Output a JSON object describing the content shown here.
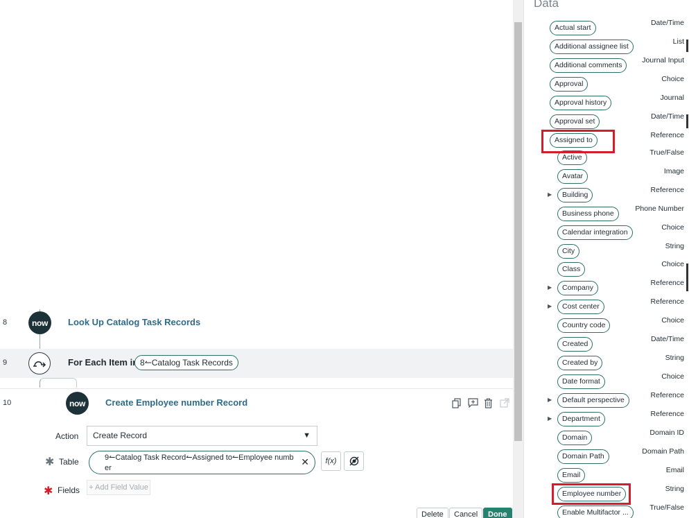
{
  "flow": {
    "step8": {
      "number": "8",
      "icon": "now-logo-icon",
      "title": "Look Up Catalog Task Records"
    },
    "step9": {
      "number": "9",
      "icon": "loop-icon",
      "prefix": "For Each Item in",
      "pill": "8↼Catalog Task Records"
    },
    "step10": {
      "number": "10",
      "icon": "now-logo-icon",
      "title": "Create Employee number Record",
      "action_label": "Action",
      "action_value": "Create Record",
      "table_label": "Table",
      "table_value": "9↼Catalog Task Record↼Assigned to↼Employee number",
      "fields_label": "Fields",
      "add_field_placeholder": "+ Add Field Value",
      "fx_label": "f(x)",
      "buttons": {
        "delete": "Delete",
        "cancel": "Cancel",
        "done": "Done"
      }
    }
  },
  "data_panel": {
    "title": "Data",
    "items": [
      {
        "label": "Actual start",
        "type": "Date/Time"
      },
      {
        "label": "Additional assignee list",
        "type": "List"
      },
      {
        "label": "Additional comments",
        "type": "Journal Input"
      },
      {
        "label": "Approval",
        "type": "Choice"
      },
      {
        "label": "Approval history",
        "type": "Journal"
      },
      {
        "label": "Approval set",
        "type": "Date/Time"
      },
      {
        "label": "Assigned to",
        "type": "Reference"
      },
      {
        "label": "Active",
        "type": "True/False"
      },
      {
        "label": "Avatar",
        "type": "Image"
      },
      {
        "label": "Building",
        "type": "Reference"
      },
      {
        "label": "Business phone",
        "type": "Phone Number"
      },
      {
        "label": "Calendar integration",
        "type": "Choice"
      },
      {
        "label": "City",
        "type": "String"
      },
      {
        "label": "Class",
        "type": "Choice"
      },
      {
        "label": "Company",
        "type": "Reference"
      },
      {
        "label": "Cost center",
        "type": "Reference"
      },
      {
        "label": "Country code",
        "type": "Choice"
      },
      {
        "label": "Created",
        "type": "Date/Time"
      },
      {
        "label": "Created by",
        "type": "String"
      },
      {
        "label": "Date format",
        "type": "Choice"
      },
      {
        "label": "Default perspective",
        "type": "Reference"
      },
      {
        "label": "Department",
        "type": "Reference"
      },
      {
        "label": "Domain",
        "type": "Domain ID"
      },
      {
        "label": "Domain Path",
        "type": "Domain Path"
      },
      {
        "label": "Email",
        "type": "Email"
      },
      {
        "label": "Employee number",
        "type": "String"
      },
      {
        "label": "Enable Multifactor ...",
        "type": "True/False"
      }
    ]
  },
  "colors": {
    "highlight": "#d41d2a",
    "pill_border": "#2b6f67",
    "link_title": "#2e6b8a",
    "primary_button": "#24826f"
  }
}
